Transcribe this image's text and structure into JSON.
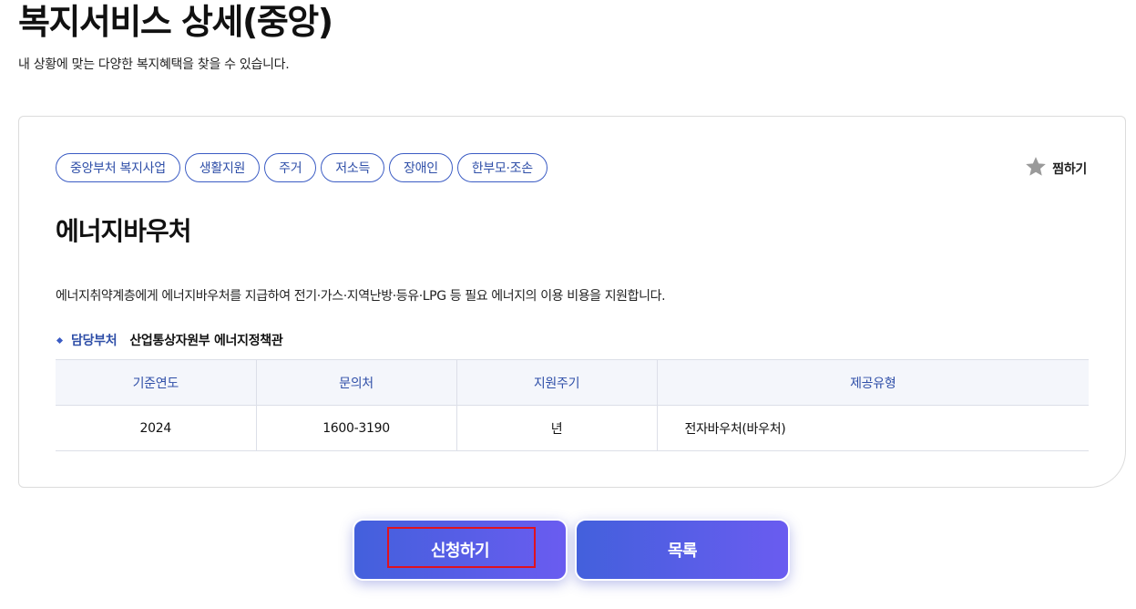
{
  "header": {
    "title": "복지서비스 상세(중앙)",
    "subtitle": "내 상황에 맞는 다양한 복지혜택을 찾을 수 있습니다."
  },
  "service": {
    "tags": [
      "중앙부처 복지사업",
      "생활지원",
      "주거",
      "저소득",
      "장애인",
      "한부모·조손"
    ],
    "favorite_label": "찜하기",
    "title": "에너지바우처",
    "description": "에너지취약계층에게 에너지바우처를 지급하여 전기·가스·지역난방·등유·LPG 등 필요 에너지의 이용 비용을 지원합니다.",
    "department_label": "담당부처",
    "department_value": "산업통상자원부 에너지정책관"
  },
  "info_table": {
    "headers": [
      "기준연도",
      "문의처",
      "지원주기",
      "제공유형"
    ],
    "row": [
      "2024",
      "1600-3190",
      "년",
      "전자바우처(바우처)"
    ]
  },
  "actions": {
    "apply_label": "신청하기",
    "list_label": "목록"
  },
  "colors": {
    "accent": "#2f4fa8",
    "button_gradient_start": "#4360dc",
    "button_gradient_end": "#6a5cf0",
    "highlight": "#e0121f"
  }
}
